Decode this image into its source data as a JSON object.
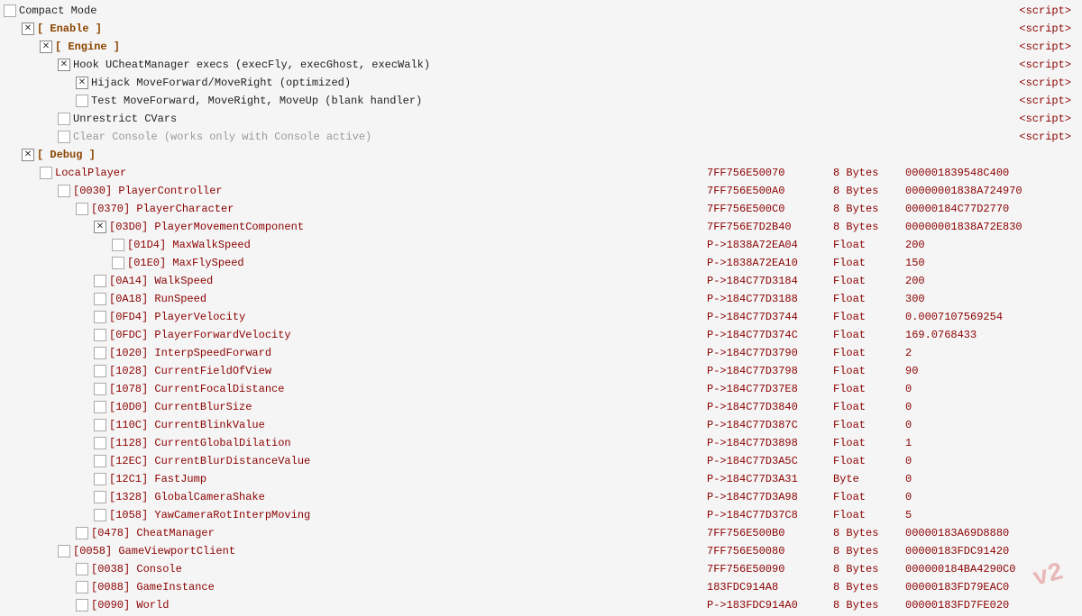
{
  "rows": [
    {
      "id": "compact-mode",
      "indent": 0,
      "checkbox": "none",
      "label": "Compact Mode",
      "label_class": "",
      "address": "",
      "size": "",
      "value": "",
      "script": "<script>",
      "interactable": true
    },
    {
      "id": "enable",
      "indent": 1,
      "checkbox": "checked",
      "label": "[ Enable ]",
      "label_class": "bracket",
      "address": "",
      "size": "",
      "value": "",
      "script": "<script>",
      "interactable": true
    },
    {
      "id": "engine",
      "indent": 2,
      "checkbox": "checked",
      "label": "[ Engine ]",
      "label_class": "bracket",
      "address": "",
      "size": "",
      "value": "",
      "script": "<script>",
      "interactable": true
    },
    {
      "id": "hook-ucheat",
      "indent": 3,
      "checkbox": "checked",
      "label": "Hook UCheatManager execs (execFly, execGhost, execWalk)",
      "label_class": "",
      "address": "",
      "size": "",
      "value": "",
      "script": "<script>",
      "interactable": true
    },
    {
      "id": "hijack-move",
      "indent": 4,
      "checkbox": "checked",
      "label": "Hijack MoveForward/MoveRight (optimized)",
      "label_class": "",
      "address": "",
      "size": "",
      "value": "",
      "script": "<script>",
      "interactable": true
    },
    {
      "id": "test-move",
      "indent": 4,
      "checkbox": "none",
      "label": "Test MoveForward, MoveRight, MoveUp (blank handler)",
      "label_class": "",
      "address": "",
      "size": "",
      "value": "",
      "script": "<script>",
      "interactable": true
    },
    {
      "id": "unrestrict",
      "indent": 3,
      "checkbox": "none",
      "label": "Unrestrict CVars",
      "label_class": "",
      "address": "",
      "size": "",
      "value": "",
      "script": "<script>",
      "interactable": true
    },
    {
      "id": "clear-console",
      "indent": 3,
      "checkbox": "none",
      "label": "Clear Console (works only with Console active)",
      "label_class": "gray",
      "address": "",
      "size": "",
      "value": "",
      "script": "<script>",
      "interactable": true
    },
    {
      "id": "debug",
      "indent": 1,
      "checkbox": "checked",
      "label": "[ Debug ]",
      "label_class": "bracket",
      "address": "",
      "size": "",
      "value": "",
      "script": "",
      "interactable": true
    },
    {
      "id": "local-player",
      "indent": 2,
      "checkbox": "none",
      "label": "LocalPlayer",
      "label_class": "dark-red",
      "address": "7FF756E50070",
      "size": "8 Bytes",
      "value": "000001839548C400",
      "script": "",
      "interactable": true
    },
    {
      "id": "player-controller",
      "indent": 3,
      "checkbox": "none",
      "label": "[0030] PlayerController",
      "label_class": "dark-red",
      "address": "7FF756E500A0",
      "size": "8 Bytes",
      "value": "00000001838A724970",
      "script": "",
      "interactable": true
    },
    {
      "id": "player-character",
      "indent": 4,
      "checkbox": "none",
      "label": "[0370] PlayerCharacter",
      "label_class": "dark-red",
      "address": "7FF756E500C0",
      "size": "8 Bytes",
      "value": "00000184C77D2770",
      "script": "",
      "interactable": true
    },
    {
      "id": "player-movement",
      "indent": 5,
      "checkbox": "checked",
      "label": "[03D0] PlayerMovementComponent",
      "label_class": "dark-red",
      "address": "7FF756E7D2B40",
      "size": "8 Bytes",
      "value": "00000001838A72E830",
      "script": "",
      "interactable": true
    },
    {
      "id": "max-walk-speed",
      "indent": 6,
      "checkbox": "none",
      "label": "[01D4] MaxWalkSpeed",
      "label_class": "dark-red",
      "address": "P->1838A72EA04",
      "size": "Float",
      "value": "200",
      "script": "",
      "interactable": true
    },
    {
      "id": "max-fly-speed",
      "indent": 6,
      "checkbox": "none",
      "label": "[01E0] MaxFlySpeed",
      "label_class": "dark-red",
      "address": "P->1838A72EA10",
      "size": "Float",
      "value": "150",
      "script": "",
      "interactable": true
    },
    {
      "id": "walk-speed",
      "indent": 5,
      "checkbox": "none",
      "label": "[0A14] WalkSpeed",
      "label_class": "dark-red",
      "address": "P->184C77D3184",
      "size": "Float",
      "value": "200",
      "script": "",
      "interactable": true
    },
    {
      "id": "run-speed",
      "indent": 5,
      "checkbox": "none",
      "label": "[0A18] RunSpeed",
      "label_class": "dark-red",
      "address": "P->184C77D3188",
      "size": "Float",
      "value": "300",
      "script": "",
      "interactable": true
    },
    {
      "id": "player-velocity",
      "indent": 5,
      "checkbox": "none",
      "label": "[0FD4] PlayerVelocity",
      "label_class": "dark-red",
      "address": "P->184C77D3744",
      "size": "Float",
      "value": "0.0007107569254",
      "script": "",
      "interactable": true
    },
    {
      "id": "player-forward-vel",
      "indent": 5,
      "checkbox": "none",
      "label": "[0FDC] PlayerForwardVelocity",
      "label_class": "dark-red",
      "address": "P->184C77D374C",
      "size": "Float",
      "value": "169.0768433",
      "script": "",
      "interactable": true
    },
    {
      "id": "interp-speed",
      "indent": 5,
      "checkbox": "none",
      "label": "[1020] InterpSpeedForward",
      "label_class": "dark-red",
      "address": "P->184C77D3790",
      "size": "Float",
      "value": "2",
      "script": "",
      "interactable": true
    },
    {
      "id": "current-fov",
      "indent": 5,
      "checkbox": "none",
      "label": "[1028] CurrentFieldOfView",
      "label_class": "dark-red",
      "address": "P->184C77D3798",
      "size": "Float",
      "value": "90",
      "script": "",
      "interactable": true
    },
    {
      "id": "current-focal",
      "indent": 5,
      "checkbox": "none",
      "label": "[1078] CurrentFocalDistance",
      "label_class": "dark-red",
      "address": "P->184C77D37E8",
      "size": "Float",
      "value": "0",
      "script": "",
      "interactable": true
    },
    {
      "id": "current-blur-size",
      "indent": 5,
      "checkbox": "none",
      "label": "[10D0] CurrentBlurSize",
      "label_class": "dark-red",
      "address": "P->184C77D3840",
      "size": "Float",
      "value": "0",
      "script": "",
      "interactable": true
    },
    {
      "id": "current-blink",
      "indent": 5,
      "checkbox": "none",
      "label": "[110C] CurrentBlinkValue",
      "label_class": "dark-red",
      "address": "P->184C77D387C",
      "size": "Float",
      "value": "0",
      "script": "",
      "interactable": true
    },
    {
      "id": "current-global-dil",
      "indent": 5,
      "checkbox": "none",
      "label": "[1128] CurrentGlobalDilation",
      "label_class": "dark-red",
      "address": "P->184C77D3898",
      "size": "Float",
      "value": "1",
      "script": "",
      "interactable": true
    },
    {
      "id": "current-blur-dist",
      "indent": 5,
      "checkbox": "none",
      "label": "[12EC] CurrentBlurDistanceValue",
      "label_class": "dark-red",
      "address": "P->184C77D3A5C",
      "size": "Float",
      "value": "0",
      "script": "",
      "interactable": true
    },
    {
      "id": "fast-jump",
      "indent": 5,
      "checkbox": "none",
      "label": "[12C1] FastJump",
      "label_class": "dark-red",
      "address": "P->184C77D3A31",
      "size": "Byte",
      "value": "0",
      "script": "",
      "interactable": true
    },
    {
      "id": "global-camera-shake",
      "indent": 5,
      "checkbox": "none",
      "label": "[1328] GlobalCameraShake",
      "label_class": "dark-red",
      "address": "P->184C77D3A98",
      "size": "Float",
      "value": "0",
      "script": "",
      "interactable": true
    },
    {
      "id": "yaw-camera",
      "indent": 5,
      "checkbox": "none",
      "label": "[1058] YawCameraRotInterpMoving",
      "label_class": "dark-red",
      "address": "P->184C77D37C8",
      "size": "Float",
      "value": "5",
      "script": "",
      "interactable": true
    },
    {
      "id": "cheat-manager",
      "indent": 4,
      "checkbox": "none",
      "label": "[0478] CheatManager",
      "label_class": "dark-red",
      "address": "7FF756E500B0",
      "size": "8 Bytes",
      "value": "00000183A69D8880",
      "script": "",
      "interactable": true
    },
    {
      "id": "game-viewport",
      "indent": 3,
      "checkbox": "none",
      "label": "[0058] GameViewportClient",
      "label_class": "dark-red",
      "address": "7FF756E50080",
      "size": "8 Bytes",
      "value": "00000183FDC91420",
      "script": "",
      "interactable": true
    },
    {
      "id": "console",
      "indent": 4,
      "checkbox": "none",
      "label": "[0038] Console",
      "label_class": "dark-red",
      "address": "7FF756E50090",
      "size": "8 Bytes",
      "value": "000000184BA4290C0",
      "script": "",
      "interactable": true
    },
    {
      "id": "game-instance",
      "indent": 4,
      "checkbox": "none",
      "label": "[0088] GameInstance",
      "label_class": "dark-red",
      "address": "183FDC914A8",
      "size": "8 Bytes",
      "value": "00000183FD79EAC0",
      "script": "",
      "interactable": true
    },
    {
      "id": "world",
      "indent": 4,
      "checkbox": "none",
      "label": "[0090] World",
      "label_class": "dark-red",
      "address": "P->183FDC914A0",
      "size": "8 Bytes",
      "value": "00000183FD7FE020",
      "script": "",
      "interactable": true
    }
  ],
  "watermark": "v2"
}
